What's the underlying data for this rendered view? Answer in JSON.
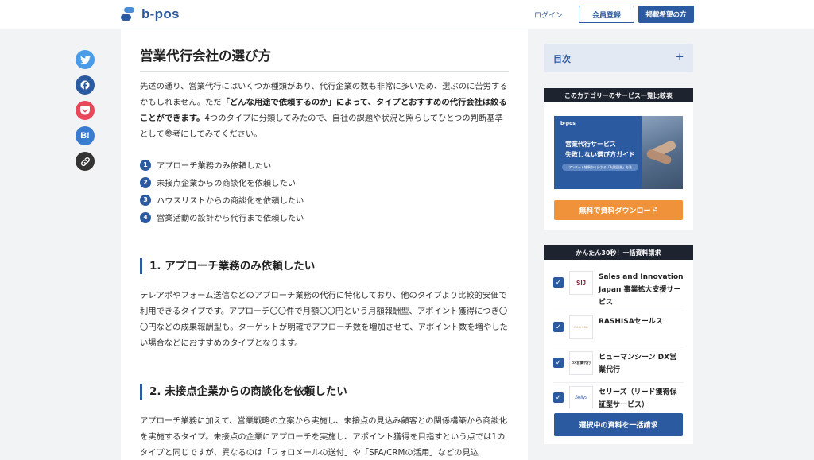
{
  "header": {
    "logo_text": "b-pos",
    "login_label": "ログイン",
    "register_label": "会員登録",
    "list_label": "掲載希望の方"
  },
  "social": {
    "icons": [
      "twitter-icon",
      "facebook-icon",
      "pocket-icon",
      "hatena-bookmark-icon",
      "link-icon"
    ],
    "twitter_glyph": "",
    "facebook_glyph": "",
    "hatena_label": "B!"
  },
  "article": {
    "section_title": "営業代行会社の選び方",
    "intro_part1": "先述の通り、営業代行にはいくつか種類があり、代行企業の数も非常に多いため、選ぶのに苦労するかもしれません。ただ",
    "intro_bold": "「どんな用途で依頼するのか」によって、タイプとおすすめの代行会社は絞ることができます。",
    "intro_part2": "4つのタイプに分類してみたので、自社の課題や状況と照らしてひとつの判断基準として参考にしてみてください。",
    "types": [
      {
        "num": "1",
        "label": "アプローチ業務のみ依頼したい"
      },
      {
        "num": "2",
        "label": "未接点企業からの商談化を依頼したい"
      },
      {
        "num": "3",
        "label": "ハウスリストからの商談化を依頼したい"
      },
      {
        "num": "4",
        "label": "営業活動の設計から代行まで依頼したい"
      }
    ],
    "h2_1": "1. アプローチ業務のみ依頼したい",
    "para_1": "テレアポやフォーム送信などのアプローチ業務の代行に特化しており、他のタイプより比較的安価で利用できるタイプです。アプローチ〇〇件で月額〇〇円という月額報酬型、アポイント獲得につき〇〇円などの成果報酬型も。ターゲットが明確でアプローチ数を増加させて、アポイント数を増やしたい場合などにおすすめのタイプとなります。",
    "h2_2": "2. 未接点企業からの商談化を依頼したい",
    "para_2": "アプローチ業務に加えて、営業戦略の立案から実施し、未接点の見込み顧客との関係構築から商談化を実施するタイプ。未接点の企業にアプローチを実施し、アポイント獲得を目指すという点では1のタイプと同じですが、異なるのは「フォロメールの送付」や「SFA/CRMの活用」などの見込"
  },
  "sidebar": {
    "toc_title": "目次",
    "toc_toggle": "+",
    "compare_head": "このカテゴリーのサービス一覧比較表",
    "banner": {
      "logo": "b-pos",
      "line1": "営業代行サービス",
      "line2": "失敗しない選び方ガイド",
      "pill": "アンケート結果から分かる「失敗回避」方法"
    },
    "download_label": "無料で資料ダウンロード",
    "bulk_head": "かんたん30秒！一括資料請求",
    "services": [
      {
        "logo": "SIJ",
        "name": "Sales and Innovation Japan 事業拡大支援サービス"
      },
      {
        "logo": "RASHISA",
        "name": "RASHISAセールス"
      },
      {
        "logo": "DX営業代行",
        "name": "ヒューマンシーン DX営業代行"
      },
      {
        "logo": "Sellys",
        "name": "セリーズ（リード獲得保証型サービス）"
      }
    ],
    "checkmark": "✓",
    "bulk_button": "選択中の資料を一括請求",
    "colors": {
      "accent": "#2c5aa0",
      "orange": "#f0923a",
      "dark": "#1e2330",
      "toc_bg": "#e3e9f3"
    }
  }
}
